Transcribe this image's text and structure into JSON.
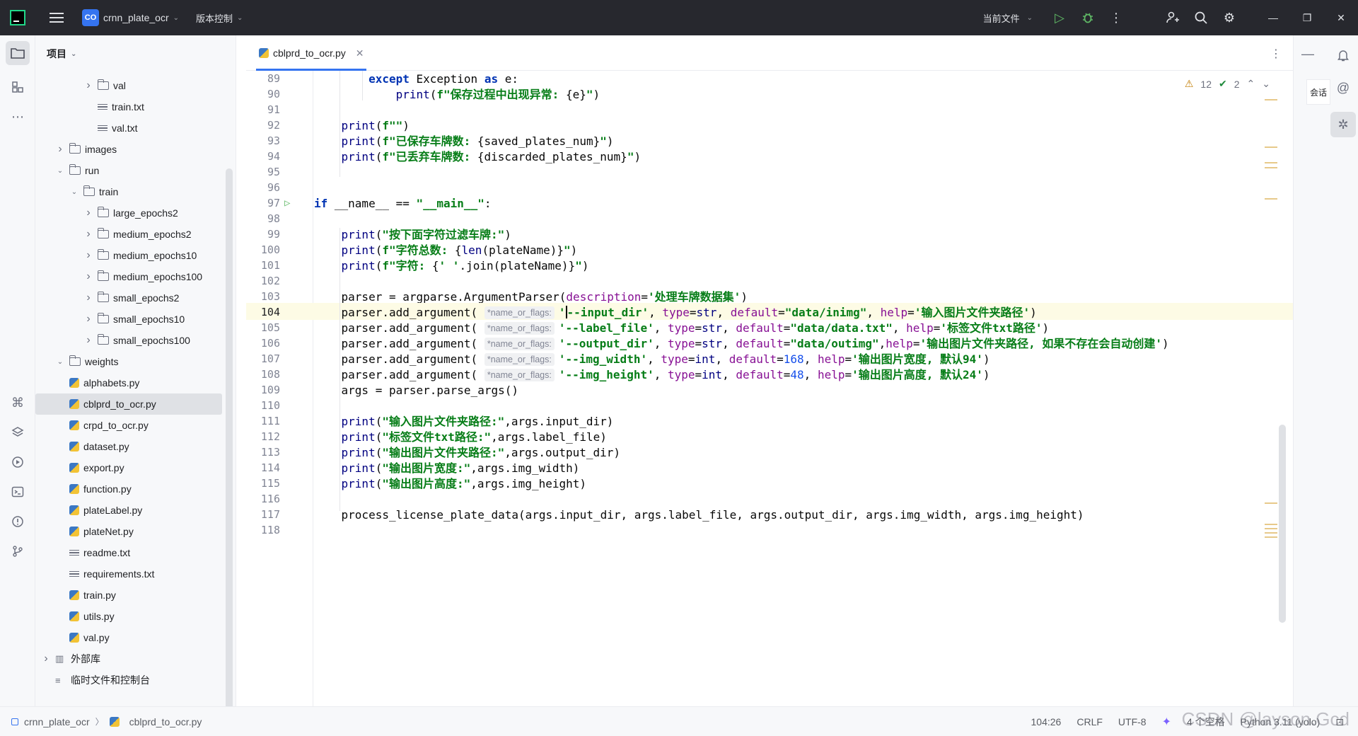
{
  "titlebar": {
    "project_badge": "CO",
    "project_name": "crnn_plate_ocr",
    "vcs_label": "版本控制",
    "run_config": "当前文件"
  },
  "project_panel": {
    "title": "项目",
    "tree": [
      {
        "label": "val",
        "type": "folder",
        "depth": 3,
        "expand": "collapsed"
      },
      {
        "label": "train.txt",
        "type": "text",
        "depth": 3
      },
      {
        "label": "val.txt",
        "type": "text",
        "depth": 3
      },
      {
        "label": "images",
        "type": "folder",
        "depth": 1,
        "expand": "collapsed"
      },
      {
        "label": "run",
        "type": "folder",
        "depth": 1,
        "expand": "expanded"
      },
      {
        "label": "train",
        "type": "folder",
        "depth": 2,
        "expand": "expanded"
      },
      {
        "label": "large_epochs2",
        "type": "folder",
        "depth": 3,
        "expand": "collapsed"
      },
      {
        "label": "medium_epochs2",
        "type": "folder",
        "depth": 3,
        "expand": "collapsed"
      },
      {
        "label": "medium_epochs10",
        "type": "folder",
        "depth": 3,
        "expand": "collapsed"
      },
      {
        "label": "medium_epochs100",
        "type": "folder",
        "depth": 3,
        "expand": "collapsed"
      },
      {
        "label": "small_epochs2",
        "type": "folder",
        "depth": 3,
        "expand": "collapsed"
      },
      {
        "label": "small_epochs10",
        "type": "folder",
        "depth": 3,
        "expand": "collapsed"
      },
      {
        "label": "small_epochs100",
        "type": "folder",
        "depth": 3,
        "expand": "collapsed"
      },
      {
        "label": "weights",
        "type": "folder",
        "depth": 1,
        "expand": "expanded"
      },
      {
        "label": "alphabets.py",
        "type": "python",
        "depth": 1
      },
      {
        "label": "cblprd_to_ocr.py",
        "type": "python",
        "depth": 1,
        "selected": true
      },
      {
        "label": "crpd_to_ocr.py",
        "type": "python",
        "depth": 1
      },
      {
        "label": "dataset.py",
        "type": "python",
        "depth": 1
      },
      {
        "label": "export.py",
        "type": "python",
        "depth": 1
      },
      {
        "label": "function.py",
        "type": "python",
        "depth": 1
      },
      {
        "label": "plateLabel.py",
        "type": "python",
        "depth": 1
      },
      {
        "label": "plateNet.py",
        "type": "python",
        "depth": 1
      },
      {
        "label": "readme.txt",
        "type": "text",
        "depth": 1
      },
      {
        "label": "requirements.txt",
        "type": "text",
        "depth": 1
      },
      {
        "label": "train.py",
        "type": "python",
        "depth": 1
      },
      {
        "label": "utils.py",
        "type": "python",
        "depth": 1
      },
      {
        "label": "val.py",
        "type": "python",
        "depth": 1
      },
      {
        "label": "外部库",
        "type": "library",
        "depth": 0,
        "expand": "collapsed"
      },
      {
        "label": "临时文件和控制台",
        "type": "scratch",
        "depth": 0
      }
    ]
  },
  "editor": {
    "tab_label": "cblprd_to_ocr.py",
    "warnings_count": "12",
    "ok_count": "2",
    "current_line": 104,
    "lines": [
      {
        "n": 89,
        "html": "        <span class=\"kw\">except</span> Exception <span class=\"kw\">as</span> e:"
      },
      {
        "n": 90,
        "html": "            <span class=\"bi\">print</span>(<span class=\"str\">f\"保存过程中出现异常: </span>{e}<span class=\"str\">\"</span>)"
      },
      {
        "n": 91,
        "html": ""
      },
      {
        "n": 92,
        "html": "    <span class=\"bi\">print</span>(<span class=\"str\">f\"\"</span>)"
      },
      {
        "n": 93,
        "html": "    <span class=\"bi\">print</span>(<span class=\"str\">f\"已保存车牌数: </span>{saved_plates_num}<span class=\"str\">\"</span>)"
      },
      {
        "n": 94,
        "html": "    <span class=\"bi\">print</span>(<span class=\"str\">f\"已丢弃车牌数: </span>{discarded_plates_num}<span class=\"str\">\"</span>)"
      },
      {
        "n": 95,
        "html": ""
      },
      {
        "n": 96,
        "html": ""
      },
      {
        "n": 97,
        "html": "<span class=\"kw\">if</span> __name__ == <span class=\"str\">\"__main__\"</span>:",
        "run": true
      },
      {
        "n": 98,
        "html": ""
      },
      {
        "n": 99,
        "html": "    <span class=\"bi\">print</span>(<span class=\"str\">\"按下面字符过滤车牌:\"</span>)"
      },
      {
        "n": 100,
        "html": "    <span class=\"bi\">print</span>(<span class=\"str\">f\"字符总数: </span>{<span class=\"bi\">len</span>(plateName)}<span class=\"str\">\"</span>)"
      },
      {
        "n": 101,
        "html": "    <span class=\"bi\">print</span>(<span class=\"str\">f\"字符: </span>{<span class=\"str\">' '</span>.join(plateName)}<span class=\"str\">\"</span>)"
      },
      {
        "n": 102,
        "html": ""
      },
      {
        "n": 103,
        "html": "    parser = argparse.ArgumentParser(<span class=\"kwa\">description</span>=<span class=\"str\">'处理车牌数据集'</span>)"
      },
      {
        "n": 104,
        "html": "    parser.add_argument( <span class=\"hint\">*name_or_flags:</span><span class=\"str\">'</span><span class=\"caret-bar\"></span><span class=\"str\">--input_dir'</span>, <span class=\"kwa\">type</span>=<span class=\"bi\">str</span>, <span class=\"kwa\">default</span>=<span class=\"str\">\"data/inimg\"</span>, <span class=\"kwa\">help</span>=<span class=\"str\">'输入图片文件夹路径'</span>)"
      },
      {
        "n": 105,
        "html": "    parser.add_argument( <span class=\"hint\">*name_or_flags:</span><span class=\"str\">'--label_file'</span>, <span class=\"kwa\">type</span>=<span class=\"bi\">str</span>, <span class=\"kwa\">default</span>=<span class=\"str\">\"data/data.txt\"</span>, <span class=\"kwa\">help</span>=<span class=\"str\">'标签文件txt路径'</span>)"
      },
      {
        "n": 106,
        "html": "    parser.add_argument( <span class=\"hint\">*name_or_flags:</span><span class=\"str\">'--output_dir'</span>, <span class=\"kwa\">type</span>=<span class=\"bi\">str</span>, <span class=\"kwa\">default</span>=<span class=\"str\">\"data/outimg\"</span>,<span class=\"kwa\">help</span>=<span class=\"str\">'输出图片文件夹路径, 如果不存在会自动创建'</span>)"
      },
      {
        "n": 107,
        "html": "    parser.add_argument( <span class=\"hint\">*name_or_flags:</span><span class=\"str\">'--img_width'</span>, <span class=\"kwa\">type</span>=<span class=\"bi\">int</span>, <span class=\"kwa\">default</span>=<span class=\"fn\">168</span>, <span class=\"kwa\">help</span>=<span class=\"str\">'输出图片宽度, 默认94'</span>)"
      },
      {
        "n": 108,
        "html": "    parser.add_argument( <span class=\"hint\">*name_or_flags:</span><span class=\"str\">'--img_height'</span>, <span class=\"kwa\">type</span>=<span class=\"bi\">int</span>, <span class=\"kwa\">default</span>=<span class=\"fn\">48</span>, <span class=\"kwa\">help</span>=<span class=\"str\">'输出图片高度, 默认24'</span>)"
      },
      {
        "n": 109,
        "html": "    args = parser.parse_args()"
      },
      {
        "n": 110,
        "html": ""
      },
      {
        "n": 111,
        "html": "    <span class=\"bi\">print</span>(<span class=\"str\">\"输入图片文件夹路径:\"</span>,args.input_dir)"
      },
      {
        "n": 112,
        "html": "    <span class=\"bi\">print</span>(<span class=\"str\">\"标签文件txt路径:\"</span>,args.label_file)"
      },
      {
        "n": 113,
        "html": "    <span class=\"bi\">print</span>(<span class=\"str\">\"输出图片文件夹路径:\"</span>,args.output_dir)"
      },
      {
        "n": 114,
        "html": "    <span class=\"bi\">print</span>(<span class=\"str\">\"输出图片宽度:\"</span>,args.img_width)"
      },
      {
        "n": 115,
        "html": "    <span class=\"bi\">print</span>(<span class=\"str\">\"输出图片高度:\"</span>,args.img_height)"
      },
      {
        "n": 116,
        "html": ""
      },
      {
        "n": 117,
        "html": "    process_license_plate_data(args.input_dir, args.label_file, args.output_dir, args.img_width, args.img_height)"
      },
      {
        "n": 118,
        "html": ""
      }
    ]
  },
  "right_panel": {
    "ai_label": "会话"
  },
  "statusbar": {
    "breadcrumb_project": "crnn_plate_ocr",
    "breadcrumb_file": "cblprd_to_ocr.py",
    "position": "104:26",
    "line_sep": "CRLF",
    "encoding": "UTF-8",
    "indent": "4 个空格",
    "interpreter": "Python 3.11 (yolo)"
  },
  "watermark": "CSDN @layson.Gcd",
  "colors": {
    "titlebar_bg": "#27282e",
    "accent": "#3574f0",
    "run_green": "#5fb865"
  }
}
